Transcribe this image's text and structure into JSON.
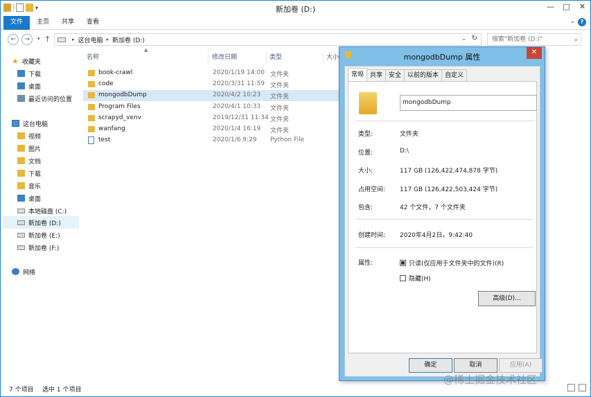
{
  "explorer": {
    "title": "新加卷 (D:)",
    "ribbon_tabs": [
      "文件",
      "主页",
      "共享",
      "查看"
    ],
    "breadcrumb": [
      "这台电脑",
      "新加卷 (D:)"
    ],
    "search_placeholder": "搜索\"新加卷 (D:)\"",
    "nav": {
      "favorites": {
        "label": "收藏夹",
        "items": [
          "下载",
          "桌面",
          "最近访问的位置"
        ]
      },
      "this_pc": {
        "label": "这台电脑",
        "items": [
          "视频",
          "图片",
          "文档",
          "下载",
          "音乐",
          "桌面",
          "本地磁盘 (C:)",
          "新加卷 (D:)",
          "新加卷 (E:)",
          "新加卷 (F:)"
        ]
      },
      "network": "网络"
    },
    "columns": {
      "name": "名称",
      "date": "修改日期",
      "type": "类型",
      "size": "大小"
    },
    "files": [
      {
        "name": "book-crawl",
        "date": "2020/1/19 14:00",
        "type": "文件夹",
        "icon": "folder-icon"
      },
      {
        "name": "code",
        "date": "2020/3/31 11:59",
        "type": "文件夹",
        "icon": "folder-icon"
      },
      {
        "name": "mongodbDump",
        "date": "2020/4/2 10:23",
        "type": "文件夹",
        "icon": "folder-icon",
        "selected": true
      },
      {
        "name": "Program Files",
        "date": "2020/4/1 10:33",
        "type": "文件夹",
        "icon": "folder-icon"
      },
      {
        "name": "scrapyd_venv",
        "date": "2019/12/31 11:34",
        "type": "文件夹",
        "icon": "folder-icon"
      },
      {
        "name": "wanfang",
        "date": "2020/1/4 16:19",
        "type": "文件夹",
        "icon": "folder-icon"
      },
      {
        "name": "test",
        "date": "2020/1/6 9:29",
        "type": "Python File",
        "icon": "python-file-icon"
      }
    ],
    "status": {
      "count": "7 个项目",
      "selected": "选中 1 个项目"
    }
  },
  "dialog": {
    "title": "mongodbDump 属性",
    "tabs": [
      "常规",
      "共享",
      "安全",
      "以前的版本",
      "自定义"
    ],
    "active_tab": "常规",
    "name": "mongodbDump",
    "type_label": "类型:",
    "type_value": "文件夹",
    "location_label": "位置:",
    "location_value": "D:\\",
    "size_label": "大小:",
    "size_value": "117 GB (126,422,474,878 字节)",
    "disk_label": "占用空间:",
    "disk_value": "117 GB (126,422,503,424 字节)",
    "contains_label": "包含:",
    "contains_value": "42 个文件，7 个文件夹",
    "created_label": "创建时间:",
    "created_value": "2020年4月2日，9:42:40",
    "attr_label": "属性:",
    "readonly_label": "只读(仅应用于文件夹中的文件)(R)",
    "hidden_label": "隐藏(H)",
    "advanced_label": "高级(D)...",
    "ok": "确定",
    "cancel": "取消",
    "apply": "应用(A)"
  },
  "watermark": "@稀土掘金技术社区"
}
